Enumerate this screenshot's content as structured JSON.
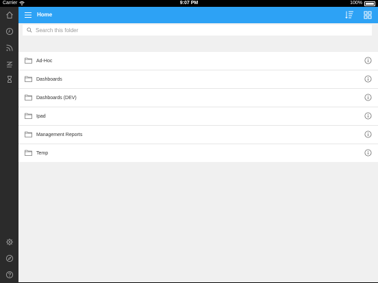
{
  "status_bar": {
    "carrier": "Carrier",
    "time": "9:07 PM",
    "battery": "100%"
  },
  "sidebar": {
    "top_items": [
      {
        "icon": "home-icon"
      },
      {
        "icon": "history-clock-icon"
      },
      {
        "icon": "feed-icon"
      },
      {
        "icon": "activity-icon"
      },
      {
        "icon": "hourglass-icon"
      }
    ],
    "bottom_items": [
      {
        "icon": "settings-gear-icon"
      },
      {
        "icon": "compass-icon"
      },
      {
        "icon": "help-icon"
      }
    ]
  },
  "navbar": {
    "title": "Home",
    "menu_icon": "hamburger-menu-icon",
    "sort_icon": "sort-icon",
    "view_icon": "grid-view-icon",
    "color": "#2da2f5"
  },
  "search": {
    "placeholder": "Search this folder",
    "value": ""
  },
  "folders": [
    {
      "name": "Ad-Hoc"
    },
    {
      "name": "Dashboards"
    },
    {
      "name": "Dashboards (DEV)"
    },
    {
      "name": "Ipad"
    },
    {
      "name": "Management Reports"
    },
    {
      "name": "Temp"
    }
  ]
}
